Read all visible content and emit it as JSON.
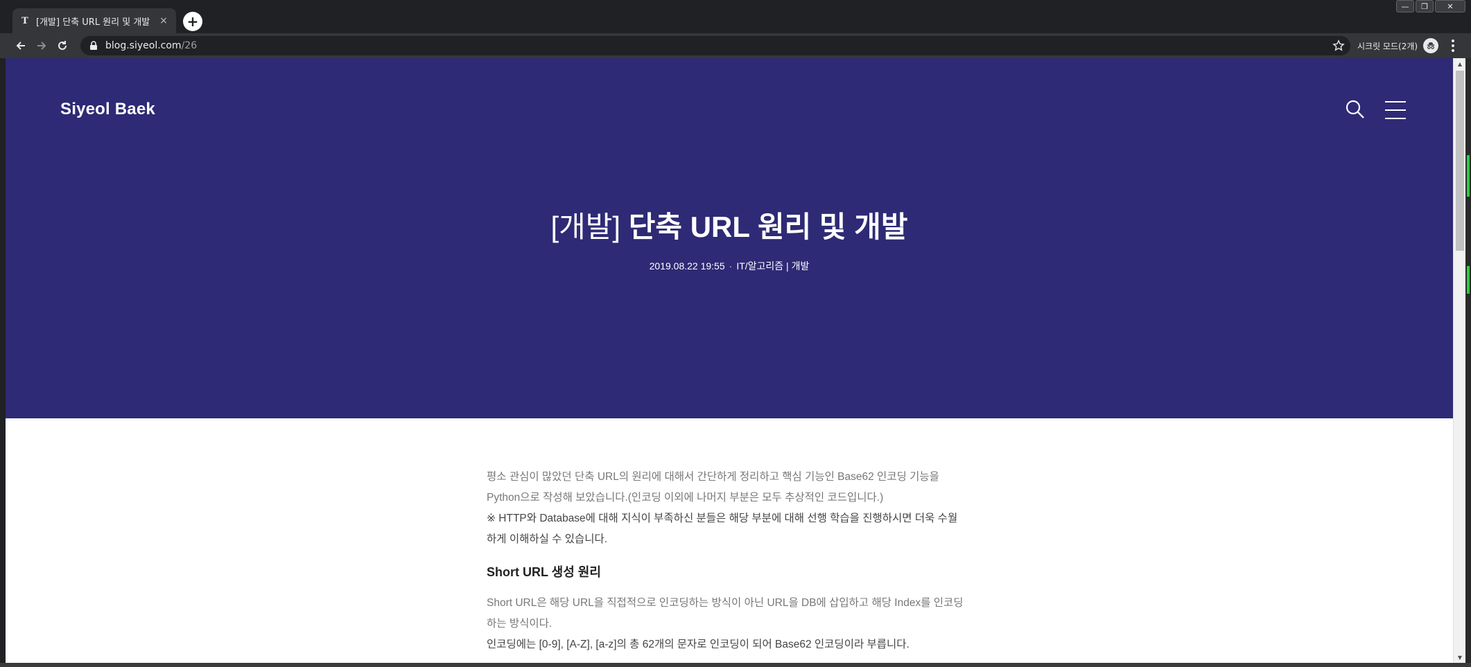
{
  "browser": {
    "tab": {
      "favicon": "T",
      "title": "[개발] 단축 URL 원리 및 개발",
      "close": "×"
    },
    "new_tab": "+",
    "window_controls": {
      "minimize": "—",
      "maximize": "❐",
      "close": "✕"
    },
    "url": {
      "host": "blog.siyeol.com",
      "path": "/26"
    },
    "incognito_label": "시크릿 모드(2개)"
  },
  "site": {
    "brand": "Siyeol Baek"
  },
  "post": {
    "title_bracket": "[개발]",
    "title_rest": " 단축 URL 원리 및 개발",
    "date": "2019.08.22 19:55",
    "separator": "·",
    "category": "IT/알고리즘 | 개발"
  },
  "article": {
    "intro_line1": "평소 관심이 많았던 단축 URL의 원리에 대해서 간단하게 정리하고 핵심 기능인 Base62 인코딩 기능을",
    "intro_line2": "Python으로 작성해 보았습니다.(인코딩 이외에 나머지 부분은 모두 추상적인 코드입니다.)",
    "note_line1": "※ HTTP와 Database에 대해 지식이 부족하신 분들은 해당 부분에 대해 선행 학습을 진행하시면 더욱 수월",
    "note_line2": "하게 이해하실 수 있습니다.",
    "section_heading": "Short URL 생성 원리",
    "para1_line1": "Short URL은 해당 URL을 직접적으로 인코딩하는 방식이 아닌 URL을 DB에 삽입하고 해당 Index를 인코딩",
    "para1_line2": "하는 방식이다.",
    "para2_line1": "인코딩에는 [0-9], [A-Z], [a-z]의 총 62개의 문자로 인코딩이 되어 Base62 인코딩이라 부릅니다."
  },
  "colors": {
    "hero_bg": "#2e2a75",
    "chrome_dark": "#202124",
    "chrome_toolbar": "#35363a"
  }
}
